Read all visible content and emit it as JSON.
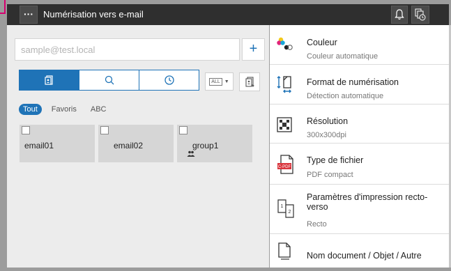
{
  "header": {
    "menu_label": "···",
    "title": "Numérisation vers e-mail",
    "bell_icon": "bell-icon",
    "job_icon": "job-status-icon"
  },
  "destination": {
    "placeholder": "sample@test.local",
    "add_label": "+"
  },
  "search_tabs": [
    {
      "icon": "address-book-icon",
      "active": true
    },
    {
      "icon": "search-icon",
      "active": false
    },
    {
      "icon": "history-clock-icon",
      "active": false
    }
  ],
  "all_filter_label": "ALL",
  "filters": [
    {
      "label": "Tout",
      "active": true
    },
    {
      "label": "Favoris",
      "active": false
    },
    {
      "label": "ABC",
      "active": false
    }
  ],
  "addresses": [
    {
      "name": "email01",
      "type": "email"
    },
    {
      "name": "email02",
      "type": "email"
    },
    {
      "name": "group1",
      "type": "group"
    }
  ],
  "settings": [
    {
      "title": "Couleur",
      "value": "Couleur automatique",
      "icon": "color-icon"
    },
    {
      "title": "Format de numérisation",
      "value": "Détection automatique",
      "icon": "scan-size-icon"
    },
    {
      "title": "Résolution",
      "value": "300x300dpi",
      "icon": "resolution-icon"
    },
    {
      "title": "Type de fichier",
      "value": "PDF compact",
      "icon": "pdf-file-icon",
      "badge": "C-PDF"
    },
    {
      "title": "Paramètres d'impression recto-verso",
      "value": "Recto",
      "icon": "duplex-icon"
    },
    {
      "title": "Nom document / Objet / Autre",
      "value": "",
      "icon": "document-name-icon"
    }
  ],
  "colors": {
    "accent": "#1f73b7",
    "topbar": "#2f2f2f",
    "marker": "#d6006f",
    "pdf_red": "#d9363e"
  }
}
